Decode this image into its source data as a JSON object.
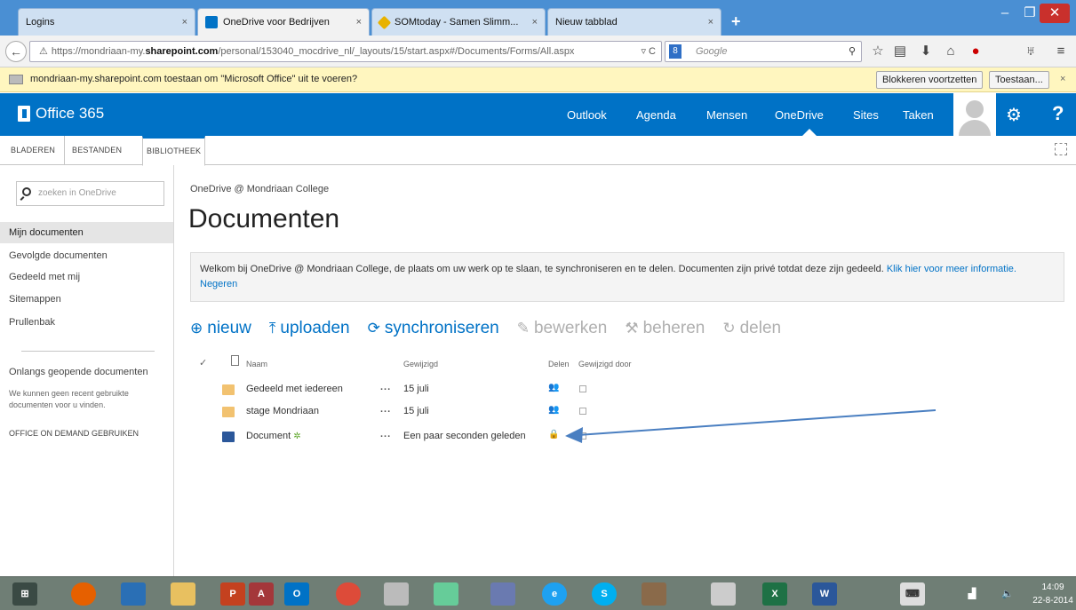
{
  "browser": {
    "tabs": [
      {
        "title": "Logins",
        "close": "×"
      },
      {
        "title": "OneDrive voor Bedrijven",
        "close": "×"
      },
      {
        "title": "SOMtoday - Samen Slimm...",
        "close": "×"
      },
      {
        "title": "Nieuw tabblad",
        "close": "×"
      }
    ],
    "new_tab": "+",
    "url_prefix": "https://mondriaan-my.",
    "url_domain": "sharepoint.com",
    "url_rest": "/personal/153040_mocdrive_nl/_layouts/15/start.aspx#/Documents/Forms/All.aspx",
    "search_placeholder": "Google",
    "search_engine_label": "8"
  },
  "notification": {
    "text": "mondriaan-my.sharepoint.com toestaan om \"Microsoft Office\" uit te voeren?",
    "block_button": "Blokkeren voortzetten",
    "allow_button": "Toestaan...",
    "close": "×"
  },
  "suitebar": {
    "brand": "Office 365",
    "links": [
      "Outlook",
      "Agenda",
      "Mensen",
      "OneDrive",
      "Sites",
      "Taken"
    ],
    "active": "OneDrive",
    "help": "?"
  },
  "ribbon": {
    "tabs": [
      "BLADEREN",
      "BESTANDEN",
      "BIBLIOTHEEK"
    ]
  },
  "leftnav": {
    "search_placeholder": "zoeken in OneDrive",
    "items": [
      "Mijn documenten",
      "Gevolgde documenten",
      "Gedeeld met mij",
      "Sitemappen",
      "Prullenbak"
    ],
    "recent_title": "Onlangs geopende documenten",
    "recent_text": "We kunnen geen recent gebruikte documenten voor u vinden.",
    "on_demand": "OFFICE ON DEMAND GEBRUIKEN"
  },
  "main": {
    "breadcrumb": "OneDrive @ Mondriaan College",
    "title": "Documenten",
    "welcome_text": "Welkom bij OneDrive @ Mondriaan College, de plaats om uw werk op te slaan, te synchroniseren en te delen. Documenten zijn privé totdat deze zijn gedeeld.",
    "welcome_link": "Klik hier voor meer informatie.",
    "welcome_dismiss": "Negeren",
    "commands": [
      {
        "label": "nieuw",
        "icon": "⊕",
        "enabled": true
      },
      {
        "label": "uploaden",
        "icon": "⤒",
        "enabled": true
      },
      {
        "label": "synchroniseren",
        "icon": "⟳",
        "enabled": true
      },
      {
        "label": "bewerken",
        "icon": "✎",
        "enabled": false
      },
      {
        "label": "beheren",
        "icon": "⚒",
        "enabled": false
      },
      {
        "label": "delen",
        "icon": "↻",
        "enabled": false
      }
    ],
    "columns": {
      "name": "Naam",
      "modified": "Gewijzigd",
      "share": "Delen",
      "modified_by": "Gewijzigd door"
    },
    "rows": [
      {
        "name": "Gedeeld met iedereen",
        "type": "folder",
        "dots": "...",
        "modified": "15 juli",
        "share_icon": "shared-people-icon"
      },
      {
        "name": "stage Mondriaan",
        "type": "folder",
        "dots": "...",
        "modified": "15 juli",
        "share_icon": "shared-people-icon"
      },
      {
        "name": "Document",
        "type": "docx",
        "dots": "...",
        "modified": "Een paar seconden geleden",
        "share_icon": "lock-icon",
        "new_mark": "✲"
      }
    ]
  },
  "taskbar": {
    "time": "14:09",
    "date": "22-8-2014"
  },
  "colors": {
    "suite_blue": "#0072c6",
    "link_blue": "#0072c6",
    "disabled_gray": "#b0b0b0",
    "annotation_arrow": "#4a7fc1"
  }
}
